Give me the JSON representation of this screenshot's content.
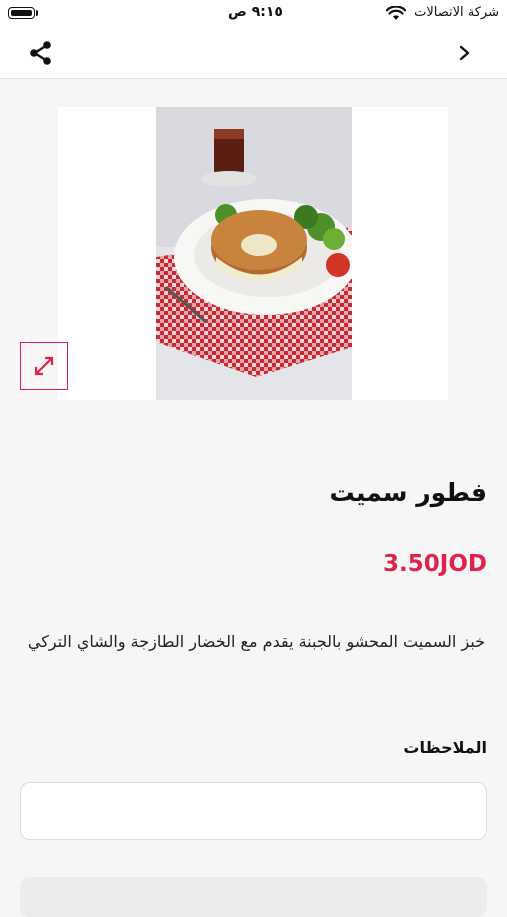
{
  "status_bar": {
    "carrier": "شركة الاتصالات",
    "time": "٩:١٥ ص",
    "wifi_icon": "wifi-icon",
    "battery_icon": "battery-icon"
  },
  "nav": {
    "back_icon": "chevron-icon",
    "share_icon": "share-icon"
  },
  "product": {
    "image_icon": "product-photo",
    "expand_icon": "expand-icon",
    "title": "فطور سميت",
    "price": "3.50JOD",
    "description": "خبز السميت المحشو بالجبنة يقدم مع الخضار الطازجة والشاي التركي"
  },
  "notes": {
    "label": "الملاحظات",
    "value": "",
    "placeholder": ""
  },
  "colors": {
    "accent": "#e0234d",
    "background": "#f6f6f6"
  }
}
